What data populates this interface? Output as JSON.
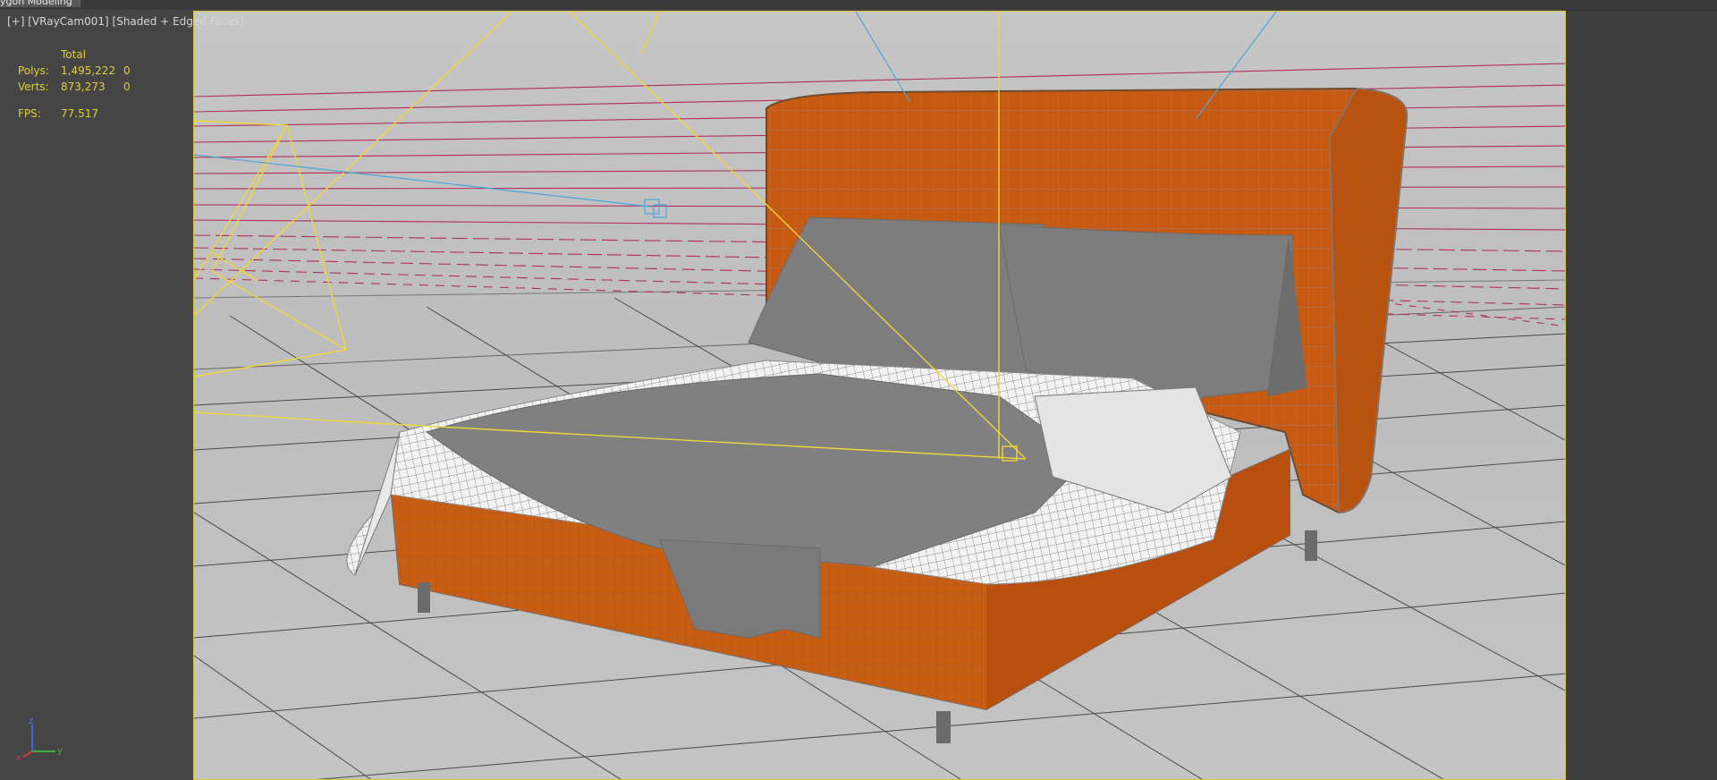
{
  "window": {
    "ribbon_tab": "ygon Modeling"
  },
  "viewport": {
    "label_plus": "[+]",
    "label_camera": "[VRayCam001]",
    "label_shading": "[Shaded + Edged Faces]",
    "scene_object": "bed-wireframe-icon"
  },
  "stats": {
    "header": "Total",
    "polys_label": "Polys:",
    "polys_total": "1,495,222",
    "polys_sel": "0",
    "verts_label": "Verts:",
    "verts_total": "873,273",
    "verts_sel": "0",
    "fps_label": "FPS:",
    "fps_value": "77.517"
  },
  "axis": {
    "z": "z",
    "y": "y",
    "x": "x"
  },
  "colors": {
    "viewport_border": "#d9c43a",
    "stats_text": "#e0cf3c",
    "fabric_orange": "#c45a12",
    "wire_grey": "#7a7a7a",
    "light_yellow": "#f0d53c",
    "target_blue": "#4aa6dc"
  }
}
